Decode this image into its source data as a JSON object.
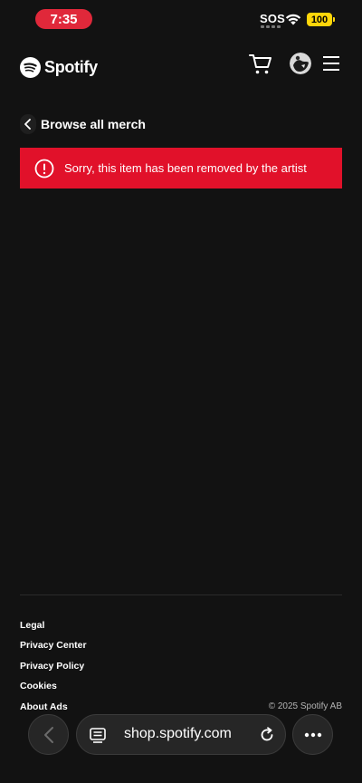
{
  "status_bar": {
    "time": "7:35",
    "carrier": "SOS",
    "battery": "100",
    "battery_color": "#ffd60a",
    "time_pill_color": "#e0283a"
  },
  "header": {
    "brand": "Spotify",
    "icons": [
      "spotify-logo-icon",
      "cart-icon",
      "avatar",
      "hamburger-menu-icon"
    ]
  },
  "back_link": {
    "label": "Browse all merch",
    "icon": "chevron-left-icon"
  },
  "error_banner": {
    "message": "Sorry, this item has been removed by the artist",
    "icon": "alert-circle-icon",
    "color": "#e1112a"
  },
  "footer": {
    "links": [
      "Legal",
      "Privacy Center",
      "Privacy Policy",
      "Cookies",
      "About Ads"
    ],
    "copyright": "© 2025 Spotify AB"
  },
  "browser": {
    "url": "shop.spotify.com",
    "icons": [
      "back-arrow-icon",
      "tabs-icon",
      "reload-icon",
      "more-icon"
    ]
  },
  "colors": {
    "background": "#121212",
    "text": "#ffffff",
    "muted_text": "#b3b3b3"
  }
}
